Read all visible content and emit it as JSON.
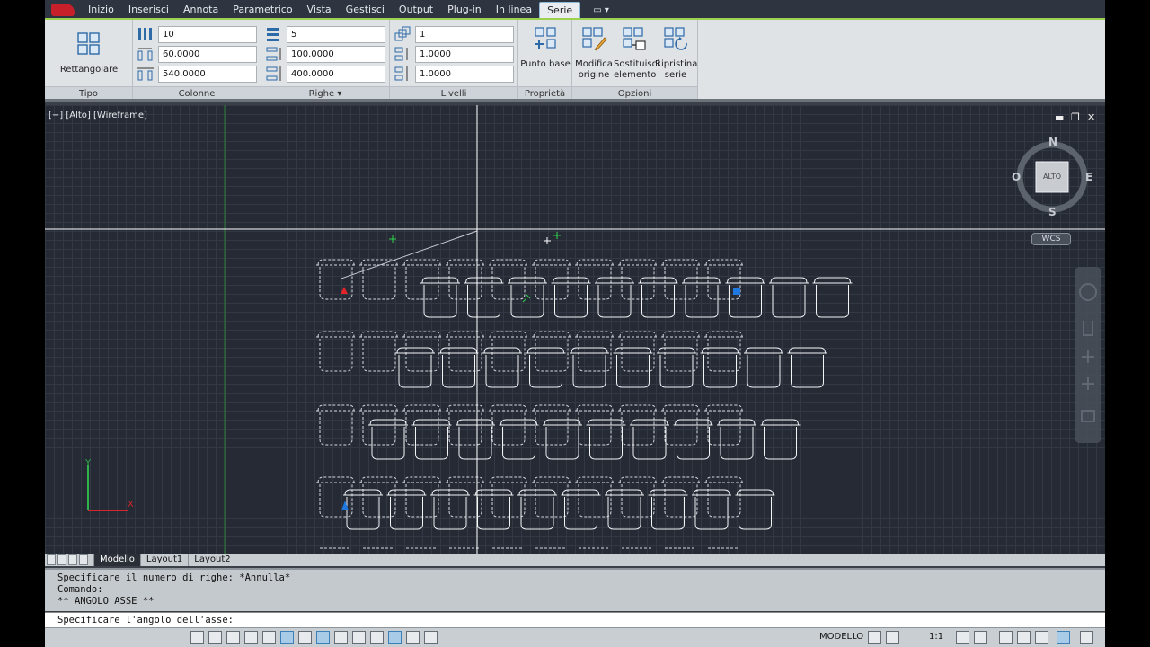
{
  "ribbon": {
    "tabs": [
      "Inizio",
      "Inserisci",
      "Annota",
      "Parametrico",
      "Vista",
      "Gestisci",
      "Output",
      "Plug-in",
      "In linea",
      "Serie"
    ],
    "active_tab": "Serie",
    "tipo": {
      "button_label": "Rettangolare",
      "panel_title": "Tipo"
    },
    "colonne": {
      "count": "10",
      "spacing": "60.0000",
      "total": "540.0000",
      "panel_title": "Colonne"
    },
    "righe": {
      "count": "5",
      "spacing": "100.0000",
      "total": "400.0000",
      "panel_title": "Righe"
    },
    "livelli": {
      "count": "1",
      "spacing": "1.0000",
      "total": "1.0000",
      "panel_title": "Livelli"
    },
    "proprieta": {
      "button_label": "Punto base",
      "panel_title": "Proprietà"
    },
    "opzioni": {
      "panel_title": "Opzioni",
      "modifica_line1": "Modifica",
      "modifica_line2": "origine",
      "sostituisci_line1": "Sostituisci",
      "sostituisci_line2": "elemento",
      "ripristina_line1": "Ripristina",
      "ripristina_line2": "serie"
    }
  },
  "viewport": {
    "label": "[−] [Alto] [Wireframe]",
    "viewcube": {
      "face": "ALTO",
      "north": "N",
      "south": "S",
      "east": "E",
      "west": "O"
    },
    "wcs": "WCS"
  },
  "layout_tabs": [
    "Modello",
    "Layout1",
    "Layout2"
  ],
  "active_layout": "Modello",
  "command": {
    "history": [
      "Specificare il numero di righe: *Annulla*",
      "Comando:",
      "** ANGOLO ASSE **"
    ],
    "prompt": "Specificare l'angolo dell'asse:"
  },
  "status": {
    "space": "MODELLO",
    "scale": "1:1"
  },
  "colors": {
    "ribbon_accent": "#9dd24f",
    "viewport_bg": "#252a35",
    "grid": "#323844",
    "crosshair": "#ffffff"
  }
}
